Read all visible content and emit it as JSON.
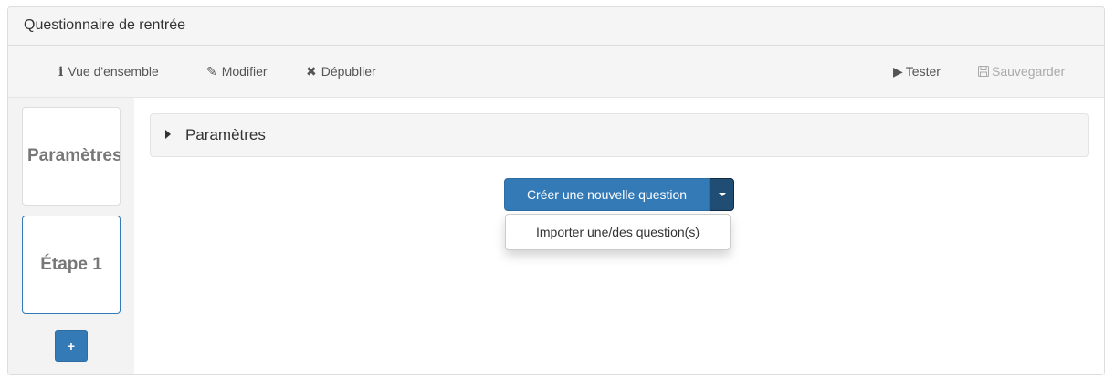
{
  "panel": {
    "title": "Questionnaire de rentrée"
  },
  "toolbar": {
    "overview_label": "Vue d'ensemble",
    "edit_label": "Modifier",
    "unpublish_label": "Dépublier",
    "test_label": "Tester",
    "save_label": "Sauvegarder"
  },
  "icons": {
    "info": "info-icon",
    "pencil": "pencil-icon",
    "close": "close-icon",
    "play": "play-icon",
    "save": "floppy-disk-icon"
  },
  "sidebar": {
    "steps": [
      {
        "label": "Paramètres"
      },
      {
        "label": "Étape 1"
      }
    ],
    "add_label": "+"
  },
  "main": {
    "params_label": "Paramètres",
    "create_button_label": "Créer une nouvelle question",
    "dropdown_items": [
      {
        "label": "Importer une/des question(s)"
      }
    ]
  },
  "colors": {
    "primary": "#337ab7",
    "primary_dark": "#204d74",
    "panel_bg": "#f5f5f5"
  }
}
